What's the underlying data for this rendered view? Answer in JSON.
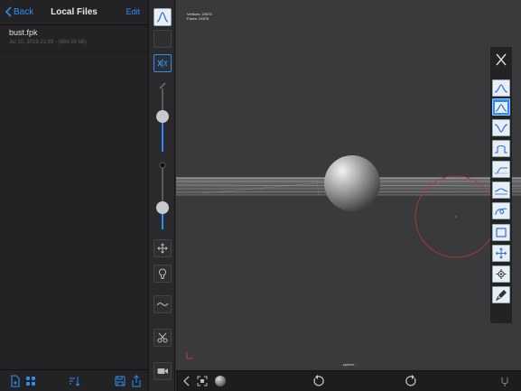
{
  "files_panel": {
    "back_label": "Back",
    "title": "Local Files",
    "edit_label": "Edit",
    "files": [
      {
        "name": "bust.fpk",
        "meta": "Jul 10, 2019 21:09 - (866.96 kB)"
      }
    ]
  },
  "viewport": {
    "stats_vertices": "Vertices: 24578",
    "stats_faces": "Faces:    24576",
    "object_label": "- sphere -"
  },
  "colors": {
    "accent": "#2f8cf6",
    "panel_bg": "#232325",
    "viewport_bg": "#3a3a3c",
    "brush_circle": "#b03a3a"
  },
  "left_toolbar": {
    "slider_1_fraction": 0.55,
    "slider_2_fraction": 0.35
  },
  "brushes": [
    "standard",
    "clay",
    "inflate",
    "smooth",
    "flatten",
    "pinch",
    "crease",
    "drag",
    "scale",
    "move",
    "mask",
    "paint"
  ]
}
